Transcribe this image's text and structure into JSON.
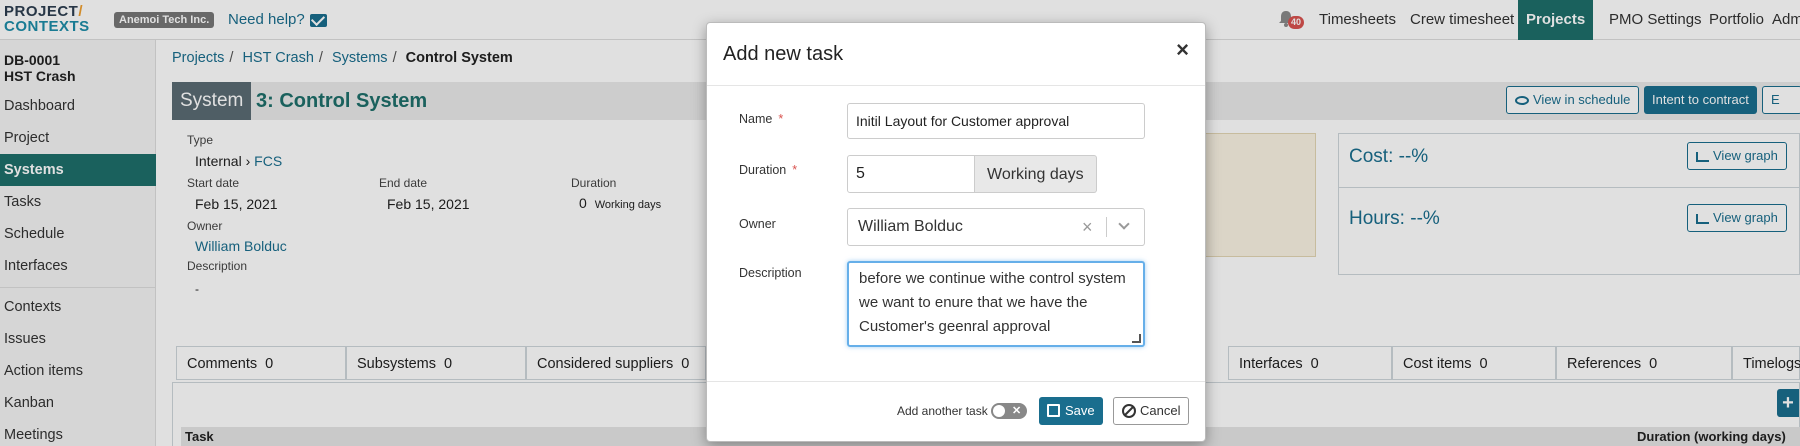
{
  "app": {
    "logo_line1": "PROJECT",
    "logo_slash": "/",
    "logo_line2": "CONTEXTS",
    "company": "Anemoi Tech Inc.",
    "need_help": "Need help?",
    "notifications": "40",
    "nav": [
      "Timesheets",
      "Crew timesheet",
      "Projects",
      "PMO Settings",
      "Portfolio",
      "Adm"
    ],
    "active_nav": "Projects",
    "accent_color": "#1e6f6a",
    "link_color": "#1a6e8e"
  },
  "sidebar": {
    "project_id": "DB-0001",
    "project_name": "HST Crash",
    "items": [
      "Dashboard",
      "Project",
      "Systems",
      "Tasks",
      "Schedule",
      "Interfaces",
      "Contexts",
      "Issues",
      "Action items",
      "Kanban",
      "Meetings"
    ],
    "active": "Systems"
  },
  "breadcrumb": [
    "Projects",
    "HST Crash",
    "Systems",
    "Control System"
  ],
  "system": {
    "tag": "System",
    "title": "3: Control System",
    "buttons": {
      "view_schedule": "View in schedule",
      "intent": "Intent to contract",
      "edit": "E"
    },
    "type_label": "Type",
    "type_value": "Internal",
    "type_link": "FCS",
    "start_label": "Start date",
    "start_value": "Feb 15, 2021",
    "end_label": "End date",
    "end_value": "Feb 15, 2021",
    "duration_label": "Duration",
    "duration_value": "0",
    "duration_unit": "Working days",
    "owner_label": "Owner",
    "owner_value": "William Bolduc",
    "description_label": "Description",
    "description_value": "-",
    "cost_label": "Cost: --%",
    "hours_label": "Hours: --%",
    "view_graph": "View graph"
  },
  "tabs": [
    {
      "label": "Comments",
      "count": "0"
    },
    {
      "label": "Subsystems",
      "count": "0"
    },
    {
      "label": "Considered suppliers",
      "count": "0"
    },
    {
      "label": "Interfaces",
      "count": "0"
    },
    {
      "label": "Cost items",
      "count": "0"
    },
    {
      "label": "References",
      "count": "0"
    },
    {
      "label": "Timelogs",
      "count": ""
    }
  ],
  "table": {
    "headers": [
      "Task",
      "Duration (working days)"
    ],
    "add_symbol": "+"
  },
  "modal": {
    "title": "Add new task",
    "close": "×",
    "name_label": "Name",
    "name_value": "Initil Layout for Customer approval",
    "duration_label": "Duration",
    "duration_value": "5",
    "duration_unit": "Working days",
    "owner_label": "Owner",
    "owner_value": "William Bolduc",
    "clear_symbol": "×",
    "description_label": "Description",
    "description_value": "before we continue withe control system we  want to enure that we have the Customer's geenral approval",
    "add_another": "Add another task",
    "toggle_x": "✕",
    "save": "Save",
    "cancel": "Cancel",
    "required_mark": "*"
  }
}
